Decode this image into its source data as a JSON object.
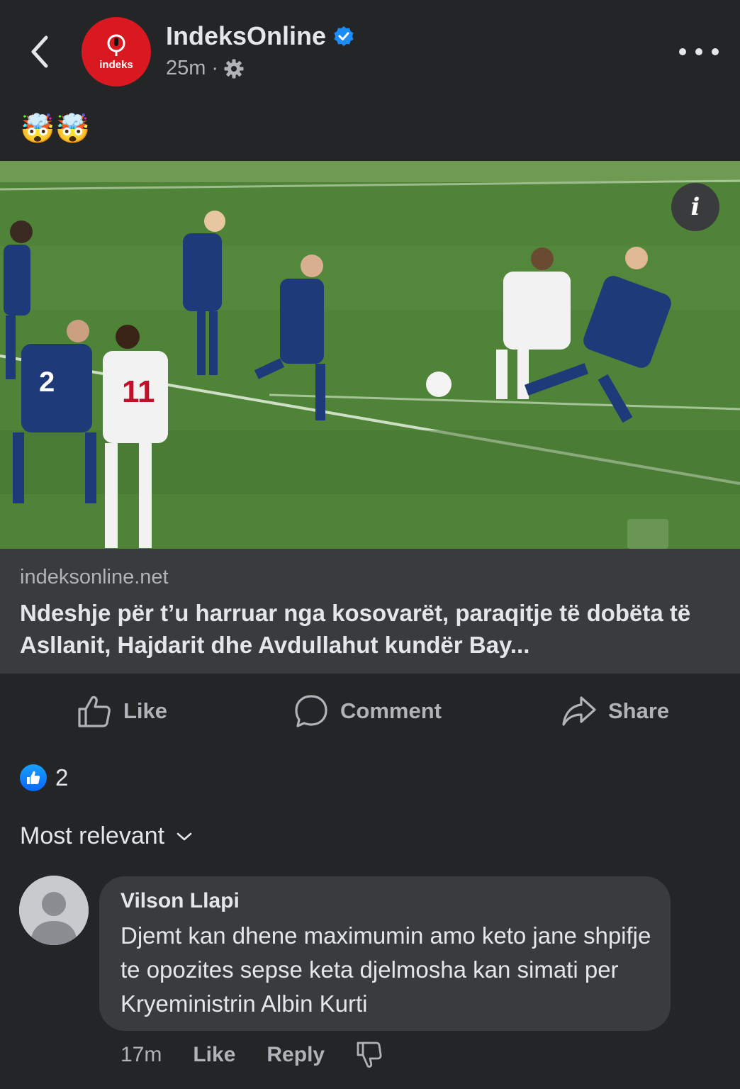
{
  "header": {
    "page_name": "IndeksOnline",
    "time": "25m",
    "avatar_logo_text": "indeks"
  },
  "post": {
    "emojis": "🤯🤯",
    "link_domain": "indeksonline.net",
    "link_title": "Ndeshje për t’u harruar nga kosovarët, paraqitje të dobëta të Asllanit, Hajdarit dhe Avdullahut kundër Bay...",
    "info_label": "i"
  },
  "actions": {
    "like": "Like",
    "comment": "Comment",
    "share": "Share"
  },
  "reactions": {
    "count": "2"
  },
  "sort": {
    "label": "Most relevant"
  },
  "comment": {
    "author": "Vilson Llapi",
    "text": "Djemt kan dhene maximumin amo keto jane shpifje te opozites sepse keta djelmosha kan simati per Kryeministrin Albin Kurti",
    "time": "17m",
    "like": "Like",
    "reply": "Reply"
  },
  "colors": {
    "background": "#242526",
    "card": "#3a3b3c",
    "text_primary": "#e4e6eb",
    "text_secondary": "#b0b3b8",
    "accent_blue": "#0866ff",
    "brand_red": "#d9191f"
  }
}
